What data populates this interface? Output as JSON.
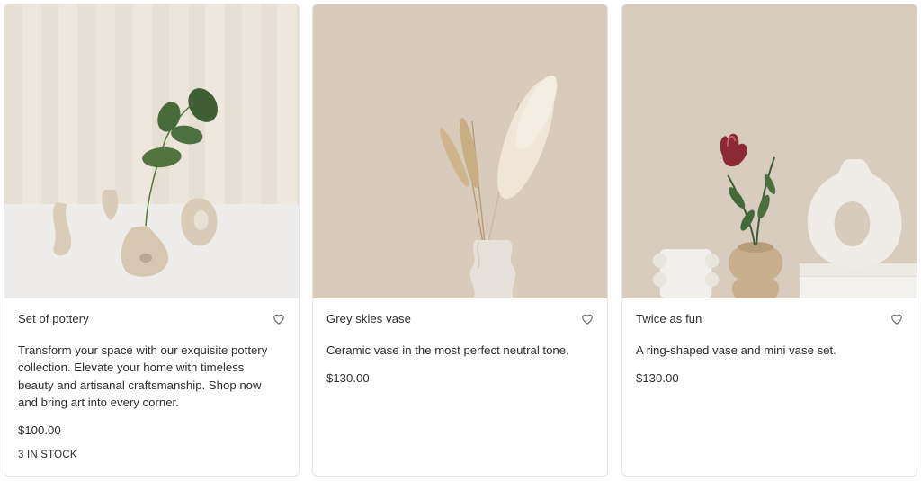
{
  "products": [
    {
      "title": "Set of pottery",
      "description": "Transform your space with our exquisite pottery collection. Elevate your home with timeless beauty and artisanal craftsmanship. Shop now and bring art into every corner.",
      "price": "$100.00",
      "stock": "3 IN STOCK",
      "image_subject": "pottery-set-with-eucalyptus",
      "favorite_icon": "heart-outline-icon"
    },
    {
      "title": "Grey skies vase",
      "description": "Ceramic vase in the most perfect neutral tone.",
      "price": "$130.00",
      "image_subject": "wavy-vase-with-pampas-grass",
      "favorite_icon": "heart-outline-icon"
    },
    {
      "title": "Twice as fun",
      "description": "A ring-shaped vase and mini vase set.",
      "price": "$130.00",
      "image_subject": "ring-vase-and-mini-vase-with-protea",
      "favorite_icon": "heart-outline-icon"
    }
  ],
  "colors": {
    "card_border": "#e4e4e4",
    "text": "#2d2d2d",
    "icon": "#6b6b6b"
  }
}
